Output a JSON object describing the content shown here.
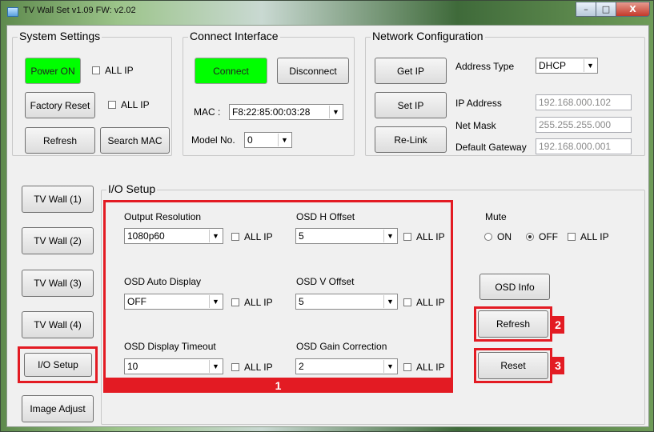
{
  "window": {
    "title": "TV Wall Set v1.09   FW: v2.02",
    "minimize_glyph": "–",
    "maximize_glyph": "□",
    "close_glyph": "X"
  },
  "system_settings": {
    "legend": "System Settings",
    "power_on": "Power ON",
    "factory_reset": "Factory Reset",
    "refresh": "Refresh",
    "search_mac": "Search MAC",
    "all_ip_1": "ALL IP",
    "all_ip_2": "ALL IP"
  },
  "connect_interface": {
    "legend": "Connect Interface",
    "connect": "Connect",
    "disconnect": "Disconnect",
    "mac_label": "MAC :",
    "mac_value": "F8:22:85:00:03:28",
    "model_label": "Model No.",
    "model_value": "0"
  },
  "network_configuration": {
    "legend": "Network Configuration",
    "get_ip": "Get IP",
    "set_ip": "Set IP",
    "relink": "Re-Link",
    "address_type_label": "Address Type",
    "address_type_value": "DHCP",
    "ip_address_label": "IP Address",
    "ip_address_value": "192.168.000.102",
    "net_mask_label": "Net Mask",
    "net_mask_value": "255.255.255.000",
    "gateway_label": "Default Gateway",
    "gateway_value": "192.168.000.001"
  },
  "left_nav": {
    "items": [
      "TV Wall (1)",
      "TV Wall (2)",
      "TV Wall (3)",
      "TV Wall (4)",
      "I/O Setup",
      "Image Adjust"
    ]
  },
  "io_setup": {
    "legend": "I/O Setup",
    "output_resolution_label": "Output Resolution",
    "output_resolution_value": "1080p60",
    "osd_auto_display_label": "OSD Auto Display",
    "osd_auto_display_value": "OFF",
    "osd_display_timeout_label": "OSD Display Timeout",
    "osd_display_timeout_value": "10",
    "osd_h_offset_label": "OSD H Offset",
    "osd_h_offset_value": "5",
    "osd_v_offset_label": "OSD V Offset",
    "osd_v_offset_value": "5",
    "osd_gain_label": "OSD Gain Correction",
    "osd_gain_value": "2",
    "all_ip": "ALL IP",
    "mute_label": "Mute",
    "mute_on": "ON",
    "mute_off": "OFF",
    "mute_all_ip": "ALL IP",
    "osd_info": "OSD Info",
    "refresh": "Refresh",
    "reset": "Reset"
  },
  "annotations": {
    "badge_1": "1",
    "badge_2": "2",
    "badge_3": "3",
    "highlight_color": "#e31b23"
  }
}
